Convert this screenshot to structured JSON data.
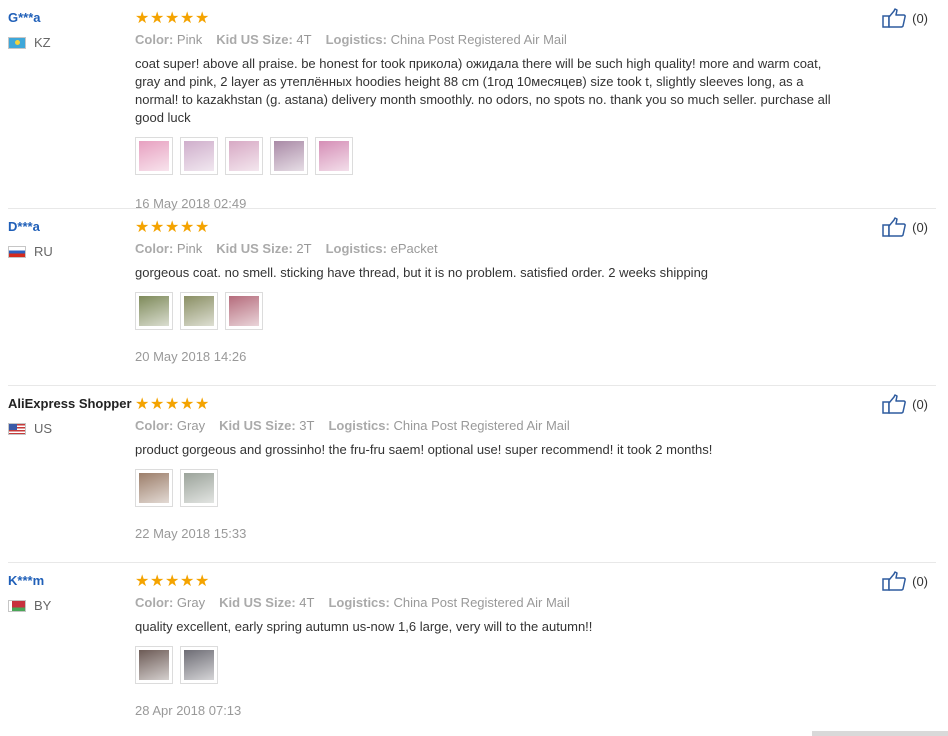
{
  "reviews": [
    {
      "user": "G***a",
      "country": "KZ",
      "flag": "kz",
      "stars": 5,
      "color_label": "Color:",
      "color": "Pink",
      "size_label": "Kid US Size:",
      "size": "4T",
      "logistics_label": "Logistics:",
      "logistics": "China Post Registered Air Mail",
      "text": "coat super! above all praise. be honest for took прикола) ожидала there will be such high quality! more and warm coat, gray and pink, 2 layer as утеплённых hoodies height 88 cm (1год 10месяцев) size took t, slightly sleeves long, as a normal! to kazakhstan (g. astana) delivery month smoothly. no odors, no spots no. thank you so much seller. purchase all good luck",
      "photos": [
        "#e7a0c0",
        "#cfaecb",
        "#d7a9c4",
        "#a98aa6",
        "#d58eb6"
      ],
      "date": "16 May 2018 02:49",
      "likes": "(0)"
    },
    {
      "user": "D***a",
      "country": "RU",
      "flag": "ru",
      "stars": 5,
      "color_label": "Color:",
      "color": "Pink",
      "size_label": "Kid US Size:",
      "size": "2T",
      "logistics_label": "Logistics:",
      "logistics": "ePacket",
      "text": "gorgeous coat. no smell. sticking have thread, but it is no problem. satisfied order. 2 weeks shipping",
      "photos": [
        "#7e8a5a",
        "#8a8f64",
        "#b56c7c"
      ],
      "date": "20 May 2018 14:26",
      "likes": "(0)"
    },
    {
      "user": "AliExpress Shopper",
      "country": "US",
      "flag": "us",
      "stars": 5,
      "color_label": "Color:",
      "color": "Gray",
      "size_label": "Kid US Size:",
      "size": "3T",
      "logistics_label": "Logistics:",
      "logistics": "China Post Registered Air Mail",
      "text": "product gorgeous and grossinho! the fru-fru saem! optional use! super recommend! it took 2 months!",
      "photos": [
        "#9c7e6a",
        "#9ba39a"
      ],
      "date": "22 May 2018 15:33",
      "likes": "(0)"
    },
    {
      "user": "K***m",
      "country": "BY",
      "flag": "by",
      "stars": 5,
      "color_label": "Color:",
      "color": "Gray",
      "size_label": "Kid US Size:",
      "size": "4T",
      "logistics_label": "Logistics:",
      "logistics": "China Post Registered Air Mail",
      "text": "quality excellent, early spring autumn us-now 1,6 large, very will to the autumn!!",
      "photos": [
        "#6c5a55",
        "#6d6c74"
      ],
      "date": "28 Apr 2018 07:13",
      "likes": "(0)"
    }
  ],
  "icons": {
    "star": "star-icon",
    "like": "thumbs-up-icon"
  },
  "colors": {
    "star": "#f4a300",
    "user_link": "#1f5fb8",
    "muted": "#999999"
  }
}
